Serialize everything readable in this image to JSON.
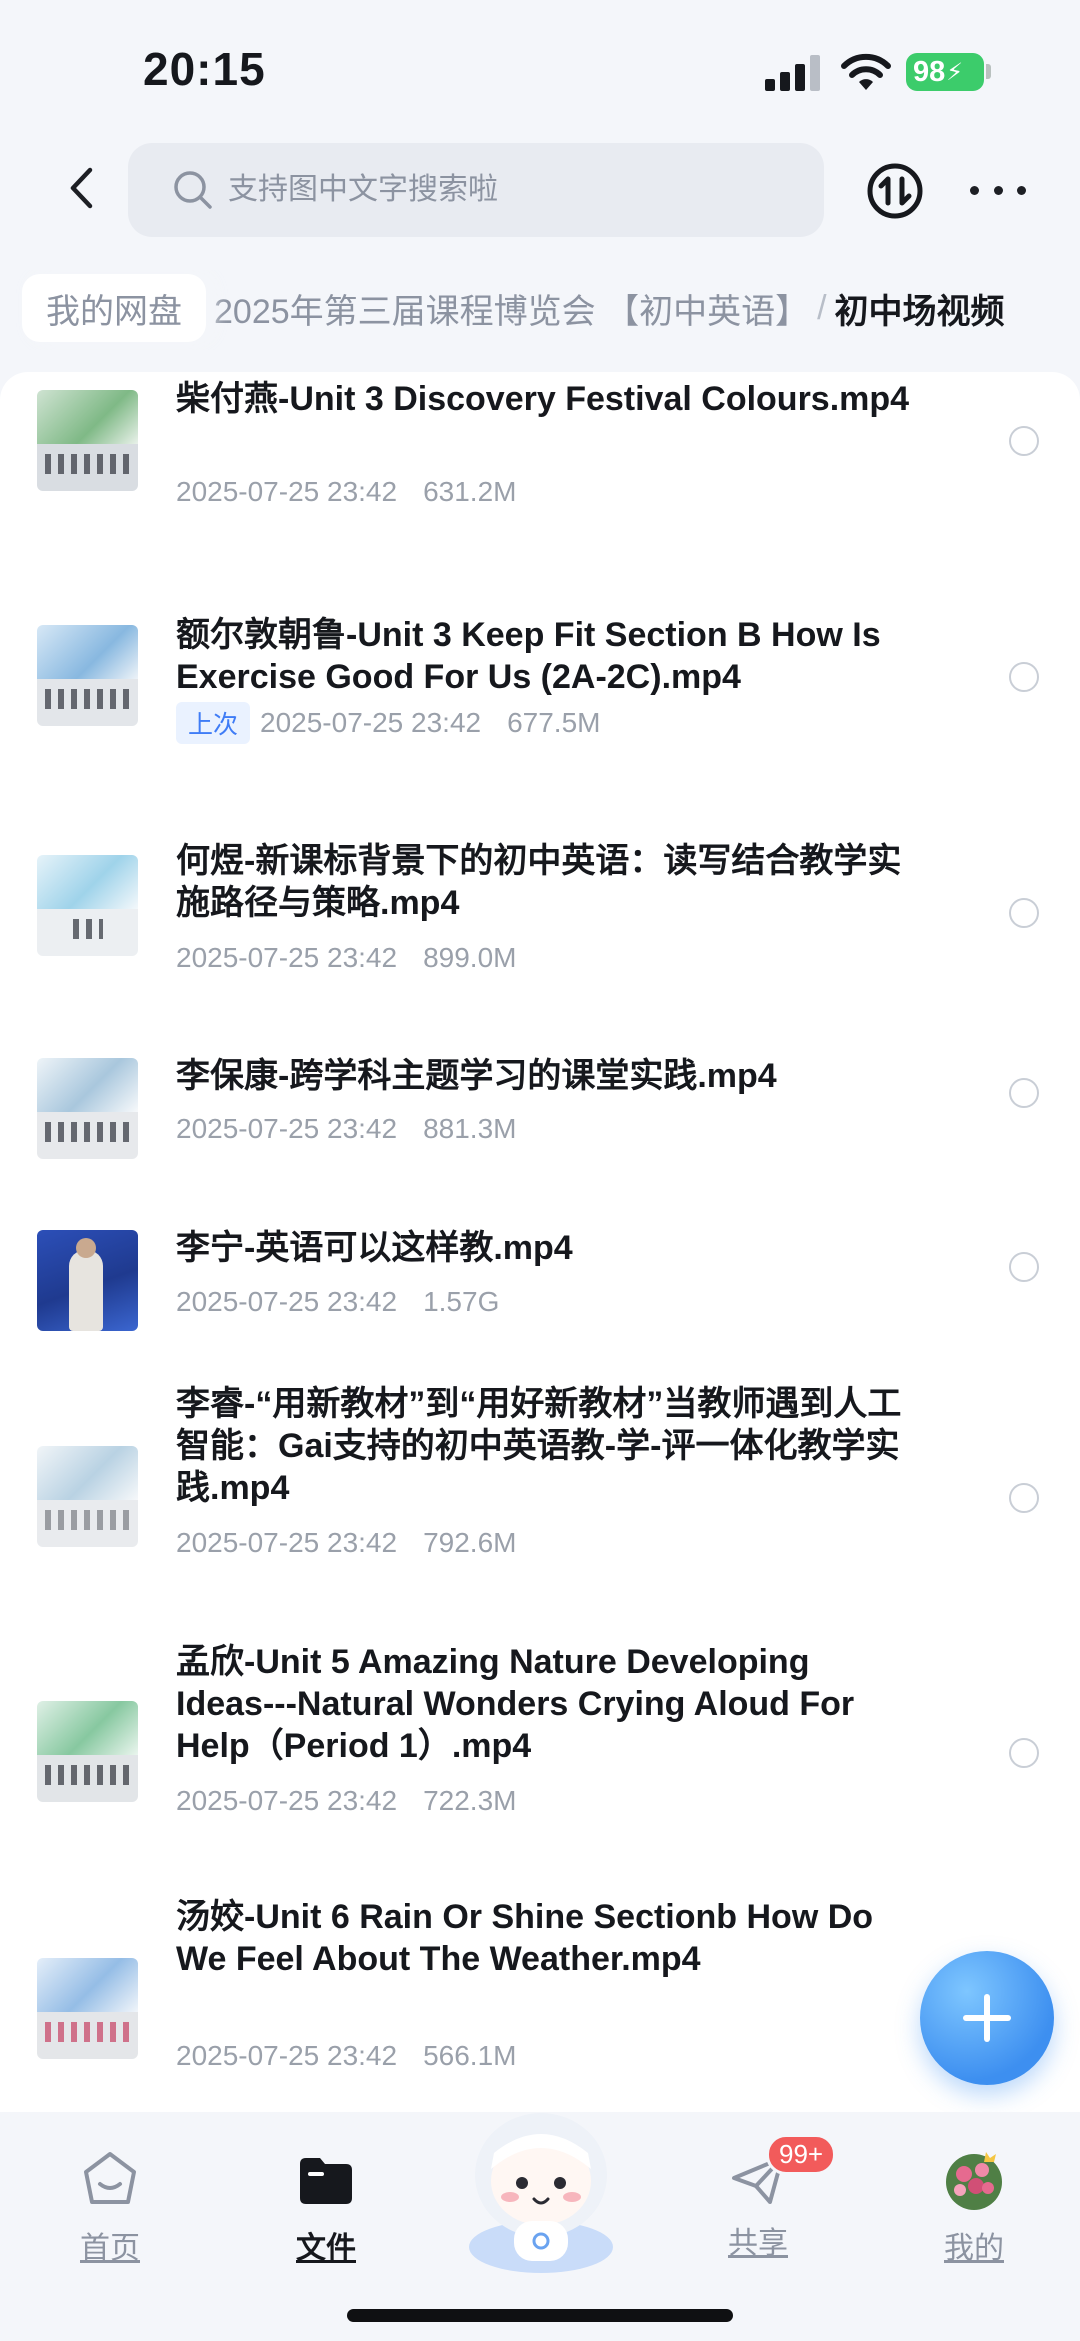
{
  "status_bar": {
    "time": "20:15",
    "battery": "98"
  },
  "search": {
    "placeholder": "支持图中文字搜索啦"
  },
  "breadcrumb": {
    "root": "我的网盘",
    "middle": "2025年第三届课程博览会 【初中英语】",
    "separator": "/",
    "current": "初中场视频"
  },
  "files": [
    {
      "name": "柴付燕-Unit 3 Discovery Festival Colours.mp4",
      "date": "2025-07-25 23:42",
      "size": "631.2M",
      "tag": ""
    },
    {
      "name": "额尔敦朝鲁-Unit 3 Keep Fit Section B How Is Exercise Good For Us (2A-2C).mp4",
      "date": "2025-07-25 23:42",
      "size": "677.5M",
      "tag": "上次"
    },
    {
      "name": "何煜-新课标背景下的初中英语：读写结合教学实施路径与策略.mp4",
      "date": "2025-07-25 23:42",
      "size": "899.0M",
      "tag": ""
    },
    {
      "name": "李保康-跨学科主题学习的课堂实践.mp4",
      "date": "2025-07-25 23:42",
      "size": "881.3M",
      "tag": ""
    },
    {
      "name": "李宁-英语可以这样教.mp4",
      "date": "2025-07-25 23:42",
      "size": "1.57G",
      "tag": ""
    },
    {
      "name": "李睿-“用新教材”到“用好新教材”当教师遇到人工智能：Gai支持的初中英语教-学-评一体化教学实践.mp4",
      "date": "2025-07-25 23:42",
      "size": "792.6M",
      "tag": ""
    },
    {
      "name": "孟欣-Unit 5 Amazing Nature Developing Ideas---Natural Wonders Crying Aloud For Help（Period 1）.mp4",
      "date": "2025-07-25 23:42",
      "size": "722.3M",
      "tag": ""
    },
    {
      "name": "汤姣-Unit 6 Rain Or Shine Sectionb How Do We Feel About The Weather.mp4",
      "date": "2025-07-25 23:42",
      "size": "566.1M",
      "tag": ""
    }
  ],
  "bottom_nav": {
    "home": "首页",
    "files": "文件",
    "share": "共享",
    "share_badge": "99+",
    "mine": "我的"
  },
  "colors": {
    "accent": "#3d8ff0",
    "battery": "#3ccc6b",
    "badge": "#f25b5b"
  }
}
